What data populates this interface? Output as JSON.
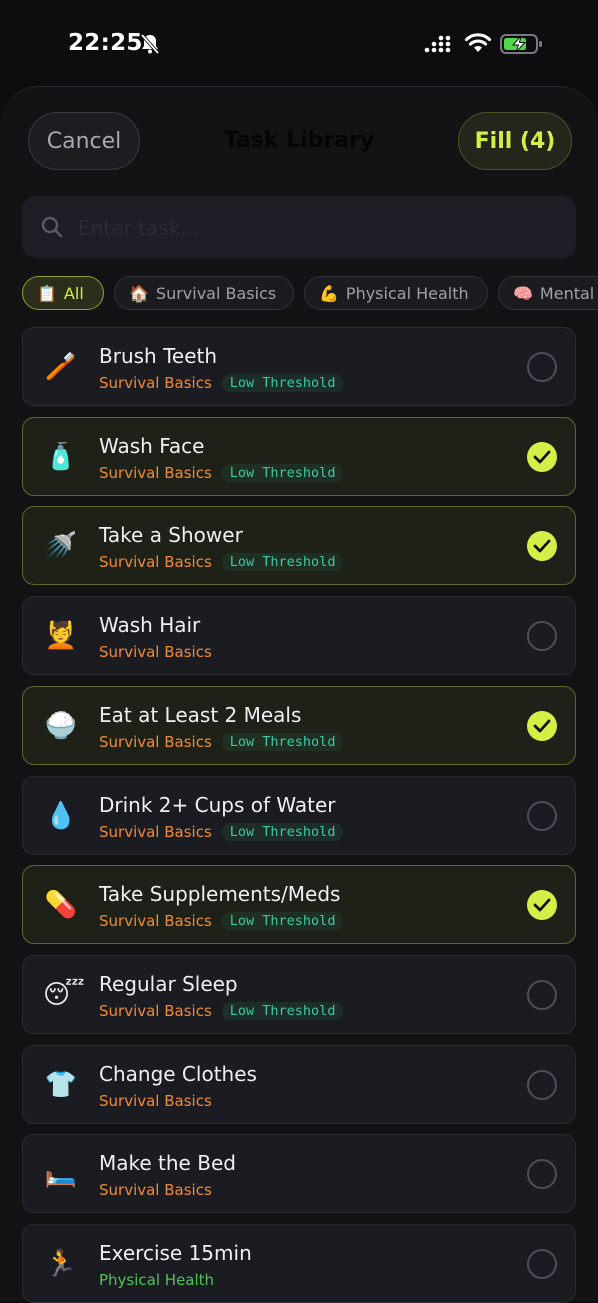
{
  "status_bar": {
    "time": "22:25"
  },
  "header": {
    "cancel_label": "Cancel",
    "title": "Task Library",
    "fill_label": "Fill (4)"
  },
  "search": {
    "placeholder": "Enter task..."
  },
  "filters": [
    {
      "emoji": "📋",
      "label": "All",
      "active": true
    },
    {
      "emoji": "🏠",
      "label": "Survival Basics",
      "active": false
    },
    {
      "emoji": "💪",
      "label": "Physical Health",
      "active": false
    },
    {
      "emoji": "🧠",
      "label": "Mental",
      "active": false
    }
  ],
  "tasks": [
    {
      "emoji": "🪥",
      "name": "Brush Teeth",
      "category": "Survival Basics",
      "tag": "Low Threshold",
      "selected": false
    },
    {
      "emoji": "🧴",
      "name": "Wash Face",
      "category": "Survival Basics",
      "tag": "Low Threshold",
      "selected": true
    },
    {
      "emoji": "🚿",
      "name": "Take a Shower",
      "category": "Survival Basics",
      "tag": "Low Threshold",
      "selected": true
    },
    {
      "emoji": "💆",
      "name": "Wash Hair",
      "category": "Survival Basics",
      "tag": "",
      "selected": false
    },
    {
      "emoji": "🍚",
      "name": "Eat at Least 2 Meals",
      "category": "Survival Basics",
      "tag": "Low Threshold",
      "selected": true
    },
    {
      "emoji": "💧",
      "name": "Drink 2+ Cups of Water",
      "category": "Survival Basics",
      "tag": "Low Threshold",
      "selected": false
    },
    {
      "emoji": "💊",
      "name": "Take Supplements/Meds",
      "category": "Survival Basics",
      "tag": "Low Threshold",
      "selected": true
    },
    {
      "emoji": "😴",
      "name": "Regular Sleep",
      "category": "Survival Basics",
      "tag": "Low Threshold",
      "selected": false
    },
    {
      "emoji": "👕",
      "name": "Change Clothes",
      "category": "Survival Basics",
      "tag": "",
      "selected": false
    },
    {
      "emoji": "🛏️",
      "name": "Make the Bed",
      "category": "Survival Basics",
      "tag": "",
      "selected": false
    },
    {
      "emoji": "🏃",
      "name": "Exercise 15min",
      "category": "Physical Health",
      "tag": "",
      "selected": false
    }
  ],
  "colors": {
    "accent": "#d4f047",
    "survival_category": "#f08b34",
    "health_category": "#4fc35a",
    "threshold_tag": "#3fc7a6"
  }
}
